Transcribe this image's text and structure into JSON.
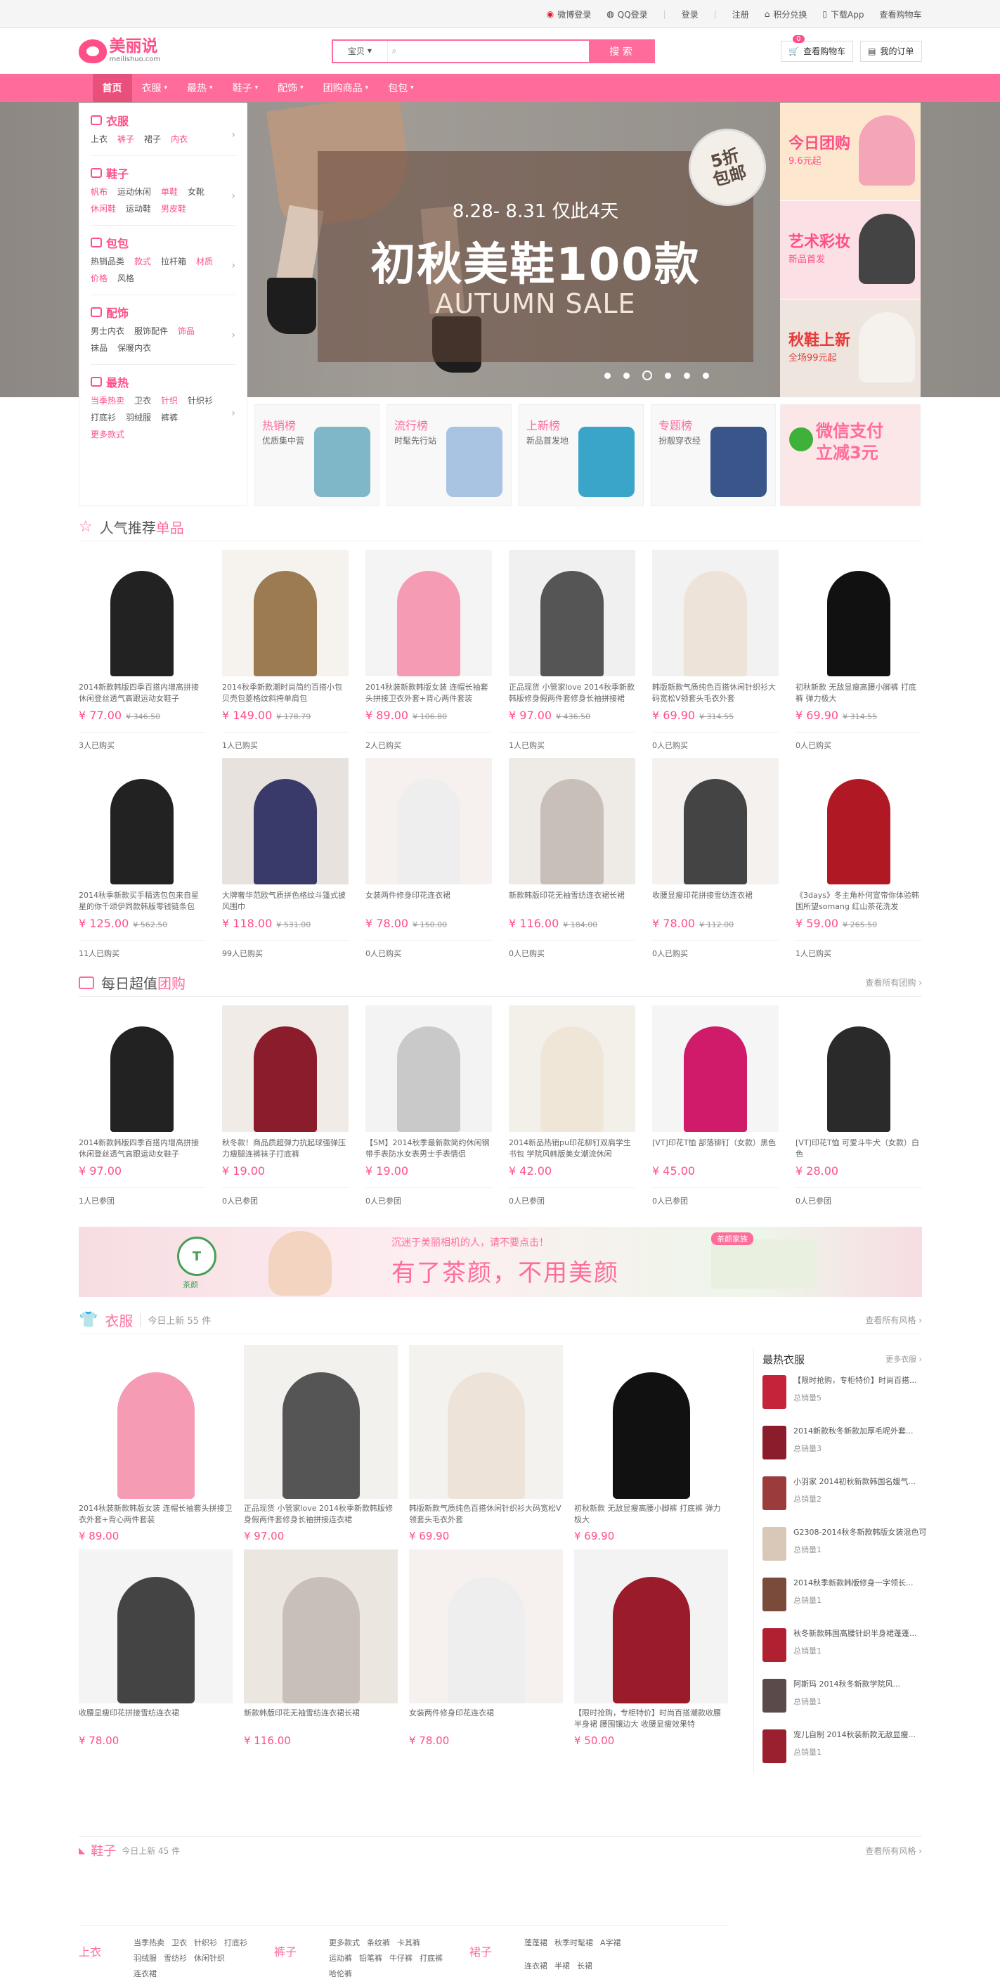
{
  "topbar": {
    "weibo_login": "微博登录",
    "qq_login": "QQ登录",
    "login": "登录",
    "register": "注册",
    "points": "积分兑换",
    "app": "下载App",
    "cart": "查看购物车"
  },
  "header": {
    "logo_cn": "美丽说",
    "logo_en": "meilishuo.com",
    "search_scope": "宝贝",
    "search_button": "搜 索",
    "cart_button": "查看购物车",
    "cart_count": "0",
    "orders_button": "我的订单"
  },
  "nav": {
    "items": [
      "首页",
      "衣服",
      "最热",
      "鞋子",
      "配饰",
      "团购商品",
      "包包"
    ]
  },
  "categories": [
    {
      "title": "衣服",
      "links": [
        {
          "t": "上衣",
          "hot": false
        },
        {
          "t": "裤子",
          "hot": true
        },
        {
          "t": "裙子",
          "hot": false
        },
        {
          "t": "内衣",
          "hot": true
        }
      ]
    },
    {
      "title": "鞋子",
      "links": [
        {
          "t": "帆布",
          "hot": true
        },
        {
          "t": "运动休闲",
          "hot": false
        },
        {
          "t": "单鞋",
          "hot": true
        },
        {
          "t": "女靴",
          "hot": false
        },
        {
          "t": "休闲鞋",
          "hot": true
        },
        {
          "t": "运动鞋",
          "hot": false
        },
        {
          "t": "男皮鞋",
          "hot": true
        }
      ]
    },
    {
      "title": "包包",
      "links": [
        {
          "t": "热销品类",
          "hot": false
        },
        {
          "t": "款式",
          "hot": true
        },
        {
          "t": "拉杆箱",
          "hot": false
        },
        {
          "t": "材质",
          "hot": true
        },
        {
          "t": "价格",
          "hot": true
        },
        {
          "t": "风格",
          "hot": false
        }
      ]
    },
    {
      "title": "配饰",
      "links": [
        {
          "t": "男士内衣",
          "hot": false
        },
        {
          "t": "服饰配件",
          "hot": false
        },
        {
          "t": "饰品",
          "hot": true
        },
        {
          "t": "袜品",
          "hot": false
        },
        {
          "t": "保暖内衣",
          "hot": false
        }
      ]
    },
    {
      "title": "最热",
      "links": [
        {
          "t": "当季热卖",
          "hot": true
        },
        {
          "t": "卫衣",
          "hot": false
        },
        {
          "t": "针织",
          "hot": true
        },
        {
          "t": "针织衫",
          "hot": false
        },
        {
          "t": "打底衫",
          "hot": false
        },
        {
          "t": "羽绒服",
          "hot": false
        },
        {
          "t": "裤裤",
          "hot": false
        },
        {
          "t": "更多款式",
          "hot": true
        }
      ]
    }
  ],
  "banner": {
    "date": "8.28- 8.31 仅此4天",
    "headline": "初秋美鞋100款",
    "sub": "AUTUMN SALE",
    "tag_line1": "5折",
    "tag_line2": "包邮"
  },
  "promos": [
    {
      "title": "今日团购",
      "sub": "9.6元起",
      "color": "#ff4f86"
    },
    {
      "title": "艺术彩妆",
      "sub": "新品首发",
      "color": "#ff4f86"
    },
    {
      "title": "秋鞋上新",
      "sub": "全场99元起",
      "color": "#e83a3a"
    }
  ],
  "tiles": [
    {
      "title": "热销榜",
      "sub": "优质集中营"
    },
    {
      "title": "流行榜",
      "sub": "时髦先行站"
    },
    {
      "title": "上新榜",
      "sub": "新品首发地"
    },
    {
      "title": "专题榜",
      "sub": "扮靓穿衣经"
    }
  ],
  "wechat": {
    "line1": "微信支付",
    "line2": "立减3元"
  },
  "popular": {
    "title": "人气推荐",
    "title_em": "单品",
    "items": [
      {
        "name": "2014新款韩版四季百搭内增高拼接休闲登丝透气高跟运动女鞋子",
        "price": "¥ 77.00",
        "old": "¥ 346.50",
        "buyers": "3人已购买"
      },
      {
        "name": "2014秋季新款潮时尚简约百搭小包贝壳包菱格纹斜挎单肩包",
        "price": "¥ 149.00",
        "old": "¥ 178.79",
        "buyers": "1人已购买"
      },
      {
        "name": "2014秋装新款韩版女装 连帽长袖套头拼接卫衣外套+背心两件套装",
        "price": "¥ 89.00",
        "old": "¥ 106.80",
        "buyers": "2人已购买"
      },
      {
        "name": "正品现货 小管家love 2014秋季新款韩版修身假两件套修身长袖拼接裙",
        "price": "¥ 97.00",
        "old": "¥ 436.50",
        "buyers": "1人已购买"
      },
      {
        "name": "韩版新款气质纯色百搭休闲针织衫大码宽松V领套头毛衣外套",
        "price": "¥ 69.90",
        "old": "¥ 314.55",
        "buyers": "0人已购买"
      },
      {
        "name": "初秋新款 无敌显瘦高腰小脚裤 打底裤 弹力极大",
        "price": "¥ 69.90",
        "old": "¥ 314.55",
        "buyers": "0人已购买"
      },
      {
        "name": "2014秋季新款买手精选包包来自星星的你千颂伊同款韩版零钱链条包",
        "price": "¥ 125.00",
        "old": "¥ 562.50",
        "buyers": "11人已购买"
      },
      {
        "name": "大牌奢华范欧气质拼色格纹斗篷式披风围巾",
        "price": "¥ 118.00",
        "old": "¥ 531.00",
        "buyers": "99人已购买"
      },
      {
        "name": "女装两件修身印花连衣裙",
        "price": "¥ 78.00",
        "old": "¥ 150.00",
        "buyers": "0人已购买"
      },
      {
        "name": "新款韩版印花无袖雪纺连衣裙长裙",
        "price": "¥ 116.00",
        "old": "¥ 184.00",
        "buyers": "0人已购买"
      },
      {
        "name": "收腰显瘦印花拼接雪纺连衣裙",
        "price": "¥ 78.00",
        "old": "¥ 112.00",
        "buyers": "0人已购买"
      },
      {
        "name": "《3days》冬主角朴何宣帝你体验韩国所望somang 红山茶花洗发",
        "price": "¥ 59.00",
        "old": "¥ 265.50",
        "buyers": "1人已购买"
      }
    ]
  },
  "daily": {
    "title": "每日超值",
    "title_em": "团购",
    "more": "查看所有团购 ›",
    "items": [
      {
        "name": "2014新款韩版四季百搭内增高拼接休闲登丝透气高跟运动女鞋子",
        "price": "¥ 97.00",
        "buyers": "1人已参团"
      },
      {
        "name": "秋冬款！商品质超弹力抗起球强弹压力瘦腿连裤袜子打底裤",
        "price": "¥ 19.00",
        "buyers": "0人已参团"
      },
      {
        "name": "【SM】2014秋季最新款简约休闲钢带手表防水女表男士手表情侣",
        "price": "¥ 19.00",
        "buyers": "0人已参团"
      },
      {
        "name": "2014新品热销pu印花柳钉双肩学生书包 学院风韩版美女潮流休闲",
        "price": "¥ 42.00",
        "buyers": "0人已参团"
      },
      {
        "name": "[VT]印花T恤 部落铆钉（女款）黑色",
        "price": "¥ 45.00",
        "buyers": "0人已参团"
      },
      {
        "name": "[VT]印花T恤 可爱斗牛犬（女款）白色",
        "price": "¥ 28.00",
        "buyers": "0人已参团"
      }
    ]
  },
  "ad": {
    "logo": "T",
    "logo_name": "茶颜",
    "line1": "沉迷于美丽相机的人，请不要点击！",
    "line2": "有了茶颜，不用美颜",
    "badge": "茶颜家族"
  },
  "clothing": {
    "title": "衣服",
    "count": "今日上新 55 件",
    "more": "查看所有风格 ›",
    "items": [
      {
        "name": "2014秋装新款韩版女装 连帽长袖套头拼接卫衣外套+背心两件套装",
        "price": "¥ 89.00"
      },
      {
        "name": "正品现货 小管家love 2014秋季新款韩版修身假两件套修身长袖拼接连衣裙",
        "price": "¥ 97.00"
      },
      {
        "name": "韩版新款气质纯色百搭休闲针织衫大码宽松V领套头毛衣外套",
        "price": "¥ 69.90"
      },
      {
        "name": "初秋新款 无敌显瘦高腰小脚裤 打底裤 弹力极大",
        "price": "¥ 69.90"
      },
      {
        "name": "收腰显瘦印花拼接雪纺连衣裙",
        "price": "¥ 78.00"
      },
      {
        "name": "新款韩版印花无袖雪纺连衣裙长裙",
        "price": "¥ 116.00"
      },
      {
        "name": "女装两件修身印花连衣裙",
        "price": "¥ 78.00"
      },
      {
        "name": "【限时抢购，专柜特价】时尚百搭潮款收腰半身裙 腰围镶边大 收腰显瘦效果特",
        "price": "¥ 50.00"
      }
    ],
    "hot_title": "最热衣服",
    "hot_more": "更多衣服 ›",
    "hot_items": [
      {
        "name": "【限时抢购，专柜特价】时尚百搭...",
        "sales": "总销量5"
      },
      {
        "name": "2014新款秋冬新款加厚毛呢外套...",
        "sales": "总销量3"
      },
      {
        "name": "小羽家 2014初秋新款韩国名媛气...",
        "sales": "总销量2"
      },
      {
        "name": "G2308-2014秋冬新款韩版女装混色可...",
        "sales": "总销量1"
      },
      {
        "name": "2014秋季新款韩版修身一字领长...",
        "sales": "总销量1"
      },
      {
        "name": "秋冬新款韩国高腰针织半身裙蓬蓬...",
        "sales": "总销量1"
      },
      {
        "name": "阿斯玛 2014秋冬新款学院风...",
        "sales": "总销量1"
      },
      {
        "name": "宠儿自制 2014秋装新款无敌显瘦...",
        "sales": "总销量1"
      }
    ],
    "keywords": [
      {
        "title": "上衣",
        "links": [
          "当季热卖",
          "卫衣",
          "针织衫",
          "打底衫",
          "羽绒服",
          "雪纺衫",
          "休闲针织",
          "连衣裙"
        ]
      },
      {
        "title": "裤子",
        "links": [
          "更多款式",
          "条纹裤",
          "卡其裤",
          "运动裤",
          "铅笔裤",
          "牛仔裤",
          "打底裤",
          "哈伦裤"
        ]
      },
      {
        "title": "裙子",
        "links": [
          "蓬蓬裙",
          "秋季时髦裙",
          "A字裙",
          "连衣裙",
          "半裙",
          "长裙"
        ]
      }
    ]
  },
  "next_section": {
    "title": "鞋子",
    "count": "今日上新 45 件",
    "more": "查看所有风格 ›"
  },
  "colors": {
    "brand": "#ff6c9b",
    "price": "#ff4f86"
  }
}
